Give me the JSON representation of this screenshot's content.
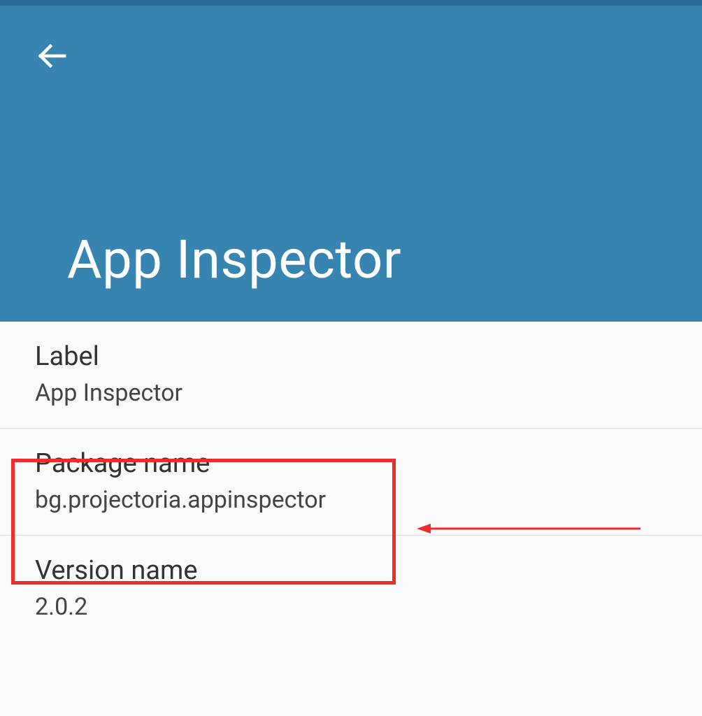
{
  "header": {
    "title": "App Inspector"
  },
  "items": [
    {
      "title": "Label",
      "value": "App Inspector"
    },
    {
      "title": "Package name",
      "value": "bg.projectoria.appinspector"
    },
    {
      "title": "Version name",
      "value": "2.0.2"
    }
  ]
}
